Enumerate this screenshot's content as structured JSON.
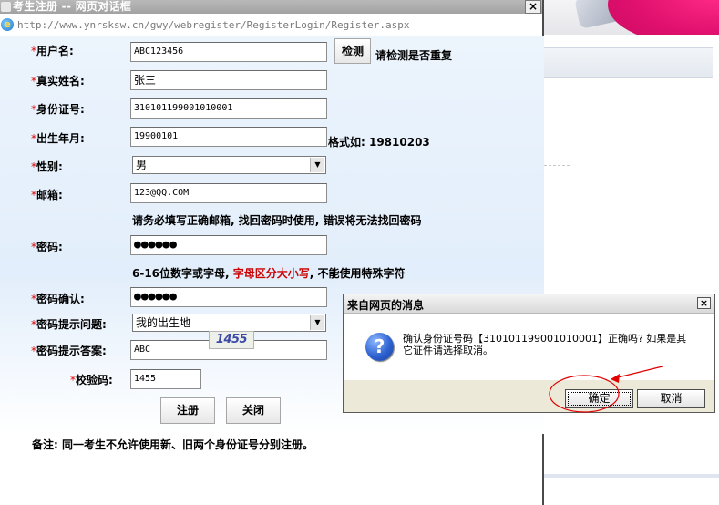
{
  "dialog": {
    "title": "考生注册 -- 网页对话框",
    "close_glyph": "×",
    "address_url": "http://www.ynrsksw.cn/gwy/webregister/RegisterLogin/Register.aspx"
  },
  "form": {
    "required_mark": "*",
    "username": {
      "label": "用户名:",
      "value": "ABC123456",
      "check_button": "检测",
      "note": "请检测是否重复"
    },
    "realname": {
      "label": "真实姓名:",
      "value": "张三"
    },
    "idnumber": {
      "label": "身份证号:",
      "value": "310101199001010001"
    },
    "birth": {
      "label": "出生年月:",
      "value": "19900101",
      "note": "格式如: 19810203"
    },
    "gender": {
      "label": "性别:",
      "selected": "男"
    },
    "email": {
      "label": "邮箱:",
      "value": "123@QQ.COM",
      "note": "请务必填写正确邮箱, 找回密码时使用, 错误将无法找回密码"
    },
    "password": {
      "label": "密码:",
      "masked": "●●●●●●",
      "note_prefix": "6-16位数字或字母, ",
      "note_red": "字母区分大小写",
      "note_suffix": ", 不能使用特殊字符"
    },
    "password_confirm": {
      "label": "密码确认:",
      "masked": "●●●●●●"
    },
    "pw_question": {
      "label": "密码提示问题:",
      "selected": "我的出生地"
    },
    "pw_answer": {
      "label": "密码提示答案:",
      "value": "ABC"
    },
    "captcha": {
      "label": "校验码:",
      "value": "1455",
      "image_text": "1455"
    },
    "buttons": {
      "register": "注册",
      "close": "关闭"
    },
    "footnote": "备注: 同一考生不允许使用新、旧两个身份证号分别注册。"
  },
  "message_box": {
    "title": "来自网页的消息",
    "close_glyph": "×",
    "icon": "question-icon",
    "icon_glyph": "?",
    "text": "确认身份证号码【310101199001010001】正确吗? 如果是其它证件请选择取消。",
    "ok": "确定",
    "cancel": "取消"
  },
  "colors": {
    "required": "#e00000",
    "warning_red": "#cc0000",
    "annotation": "#e00000",
    "banner_pink": "#e0106e"
  }
}
